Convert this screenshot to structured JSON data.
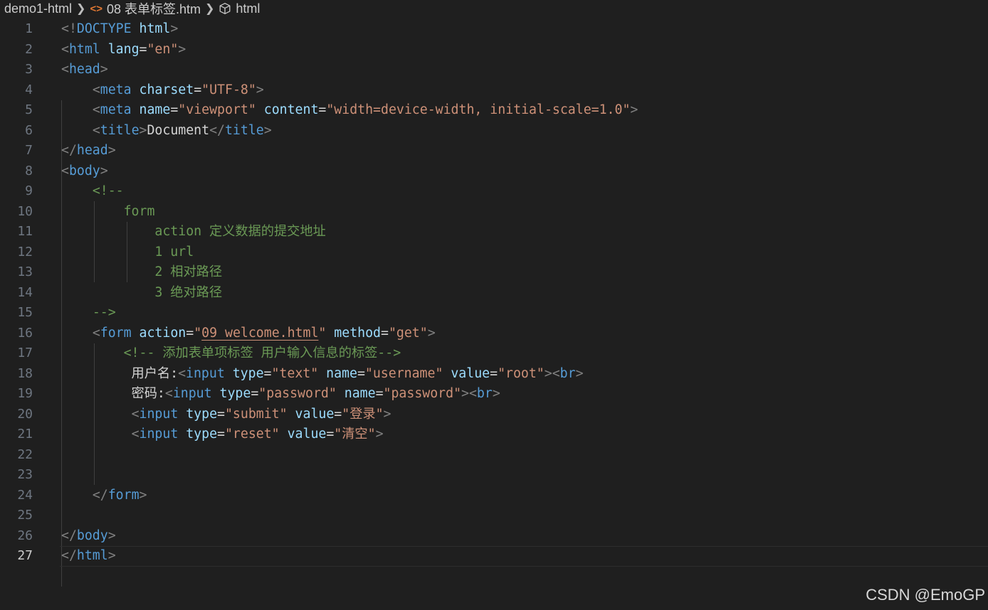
{
  "breadcrumb": {
    "folder": "demo1-html",
    "file": "08 表单标签.htm",
    "symbol": "html",
    "file_icon_glyph": "<>",
    "file_icon_color": "#e37933"
  },
  "editor": {
    "current_line": 27,
    "theme_colors": {
      "background": "#1f1f1f",
      "tag": "#569cd6",
      "attribute": "#9cdcfe",
      "string": "#ce9178",
      "comment": "#6a9955",
      "punctuation": "#808080",
      "text": "#d4d4d4",
      "line_number": "#6e7681"
    },
    "lines": [
      {
        "number": "1",
        "tokens": [
          {
            "t": "p",
            "v": "<!"
          },
          {
            "t": "tag",
            "v": "DOCTYPE"
          },
          {
            "t": "txt",
            "v": " "
          },
          {
            "t": "attr",
            "v": "html"
          },
          {
            "t": "p",
            "v": ">"
          }
        ]
      },
      {
        "number": "2",
        "tokens": [
          {
            "t": "p",
            "v": "<"
          },
          {
            "t": "tag",
            "v": "html"
          },
          {
            "t": "txt",
            "v": " "
          },
          {
            "t": "attr",
            "v": "lang"
          },
          {
            "t": "txt",
            "v": "="
          },
          {
            "t": "str",
            "v": "\"en\""
          },
          {
            "t": "p",
            "v": ">"
          }
        ]
      },
      {
        "number": "3",
        "tokens": [
          {
            "t": "p",
            "v": "<"
          },
          {
            "t": "tag",
            "v": "head"
          },
          {
            "t": "p",
            "v": ">"
          }
        ]
      },
      {
        "number": "4",
        "tokens": [
          {
            "t": "txt",
            "v": "    "
          },
          {
            "t": "p",
            "v": "<"
          },
          {
            "t": "tag",
            "v": "meta"
          },
          {
            "t": "txt",
            "v": " "
          },
          {
            "t": "attr",
            "v": "charset"
          },
          {
            "t": "txt",
            "v": "="
          },
          {
            "t": "str",
            "v": "\"UTF-8\""
          },
          {
            "t": "p",
            "v": ">"
          }
        ]
      },
      {
        "number": "5",
        "tokens": [
          {
            "t": "txt",
            "v": "    "
          },
          {
            "t": "p",
            "v": "<"
          },
          {
            "t": "tag",
            "v": "meta"
          },
          {
            "t": "txt",
            "v": " "
          },
          {
            "t": "attr",
            "v": "name"
          },
          {
            "t": "txt",
            "v": "="
          },
          {
            "t": "str",
            "v": "\"viewport\""
          },
          {
            "t": "txt",
            "v": " "
          },
          {
            "t": "attr",
            "v": "content"
          },
          {
            "t": "txt",
            "v": "="
          },
          {
            "t": "str",
            "v": "\"width=device-width, initial-scale=1.0\""
          },
          {
            "t": "p",
            "v": ">"
          }
        ]
      },
      {
        "number": "6",
        "tokens": [
          {
            "t": "txt",
            "v": "    "
          },
          {
            "t": "p",
            "v": "<"
          },
          {
            "t": "tag",
            "v": "title"
          },
          {
            "t": "p",
            "v": ">"
          },
          {
            "t": "txt",
            "v": "Document"
          },
          {
            "t": "p",
            "v": "</"
          },
          {
            "t": "tag",
            "v": "title"
          },
          {
            "t": "p",
            "v": ">"
          }
        ]
      },
      {
        "number": "7",
        "tokens": [
          {
            "t": "p",
            "v": "</"
          },
          {
            "t": "tag",
            "v": "head"
          },
          {
            "t": "p",
            "v": ">"
          }
        ]
      },
      {
        "number": "8",
        "tokens": [
          {
            "t": "p",
            "v": "<"
          },
          {
            "t": "tag",
            "v": "body"
          },
          {
            "t": "p",
            "v": ">"
          }
        ]
      },
      {
        "number": "9",
        "tokens": [
          {
            "t": "txt",
            "v": "    "
          },
          {
            "t": "com",
            "v": "<!--"
          }
        ]
      },
      {
        "number": "10",
        "tokens": [
          {
            "t": "txt",
            "v": "        "
          },
          {
            "t": "com",
            "v": "form"
          }
        ]
      },
      {
        "number": "11",
        "tokens": [
          {
            "t": "txt",
            "v": "            "
          },
          {
            "t": "com",
            "v": "action 定义数据的提交地址"
          }
        ]
      },
      {
        "number": "12",
        "tokens": [
          {
            "t": "txt",
            "v": "            "
          },
          {
            "t": "com",
            "v": "1 url"
          }
        ]
      },
      {
        "number": "13",
        "tokens": [
          {
            "t": "txt",
            "v": "            "
          },
          {
            "t": "com",
            "v": "2 相对路径"
          }
        ]
      },
      {
        "number": "14",
        "tokens": [
          {
            "t": "txt",
            "v": "            "
          },
          {
            "t": "com",
            "v": "3 绝对路径"
          }
        ]
      },
      {
        "number": "15",
        "tokens": [
          {
            "t": "txt",
            "v": "    "
          },
          {
            "t": "com",
            "v": "-->"
          }
        ]
      },
      {
        "number": "16",
        "tokens": [
          {
            "t": "txt",
            "v": "    "
          },
          {
            "t": "p",
            "v": "<"
          },
          {
            "t": "tag",
            "v": "form"
          },
          {
            "t": "txt",
            "v": " "
          },
          {
            "t": "attr",
            "v": "action"
          },
          {
            "t": "txt",
            "v": "="
          },
          {
            "t": "str",
            "v": "\""
          },
          {
            "t": "str-u",
            "v": "09 welcome.html"
          },
          {
            "t": "str",
            "v": "\""
          },
          {
            "t": "txt",
            "v": " "
          },
          {
            "t": "attr",
            "v": "method"
          },
          {
            "t": "txt",
            "v": "="
          },
          {
            "t": "str",
            "v": "\"get\""
          },
          {
            "t": "p",
            "v": ">"
          }
        ]
      },
      {
        "number": "17",
        "tokens": [
          {
            "t": "txt",
            "v": "        "
          },
          {
            "t": "com",
            "v": "<!-- 添加表单项标签 用户输入信息的标签-->"
          }
        ]
      },
      {
        "number": "18",
        "tokens": [
          {
            "t": "txt",
            "v": "         用户名:"
          },
          {
            "t": "p",
            "v": "<"
          },
          {
            "t": "tag",
            "v": "input"
          },
          {
            "t": "txt",
            "v": " "
          },
          {
            "t": "attr",
            "v": "type"
          },
          {
            "t": "txt",
            "v": "="
          },
          {
            "t": "str",
            "v": "\"text\""
          },
          {
            "t": "txt",
            "v": " "
          },
          {
            "t": "attr",
            "v": "name"
          },
          {
            "t": "txt",
            "v": "="
          },
          {
            "t": "str",
            "v": "\"username\""
          },
          {
            "t": "txt",
            "v": " "
          },
          {
            "t": "attr",
            "v": "value"
          },
          {
            "t": "txt",
            "v": "="
          },
          {
            "t": "str",
            "v": "\"root\""
          },
          {
            "t": "p",
            "v": "><"
          },
          {
            "t": "tag",
            "v": "br"
          },
          {
            "t": "p",
            "v": ">"
          }
        ]
      },
      {
        "number": "19",
        "tokens": [
          {
            "t": "txt",
            "v": "         密码:"
          },
          {
            "t": "p",
            "v": "<"
          },
          {
            "t": "tag",
            "v": "input"
          },
          {
            "t": "txt",
            "v": " "
          },
          {
            "t": "attr",
            "v": "type"
          },
          {
            "t": "txt",
            "v": "="
          },
          {
            "t": "str",
            "v": "\"password\""
          },
          {
            "t": "txt",
            "v": " "
          },
          {
            "t": "attr",
            "v": "name"
          },
          {
            "t": "txt",
            "v": "="
          },
          {
            "t": "str",
            "v": "\"password\""
          },
          {
            "t": "p",
            "v": "><"
          },
          {
            "t": "tag",
            "v": "br"
          },
          {
            "t": "p",
            "v": ">"
          }
        ]
      },
      {
        "number": "20",
        "tokens": [
          {
            "t": "txt",
            "v": "         "
          },
          {
            "t": "p",
            "v": "<"
          },
          {
            "t": "tag",
            "v": "input"
          },
          {
            "t": "txt",
            "v": " "
          },
          {
            "t": "attr",
            "v": "type"
          },
          {
            "t": "txt",
            "v": "="
          },
          {
            "t": "str",
            "v": "\"submit\""
          },
          {
            "t": "txt",
            "v": " "
          },
          {
            "t": "attr",
            "v": "value"
          },
          {
            "t": "txt",
            "v": "="
          },
          {
            "t": "str",
            "v": "\"登录\""
          },
          {
            "t": "p",
            "v": ">"
          }
        ]
      },
      {
        "number": "21",
        "tokens": [
          {
            "t": "txt",
            "v": "         "
          },
          {
            "t": "p",
            "v": "<"
          },
          {
            "t": "tag",
            "v": "input"
          },
          {
            "t": "txt",
            "v": " "
          },
          {
            "t": "attr",
            "v": "type"
          },
          {
            "t": "txt",
            "v": "="
          },
          {
            "t": "str",
            "v": "\"reset\""
          },
          {
            "t": "txt",
            "v": " "
          },
          {
            "t": "attr",
            "v": "value"
          },
          {
            "t": "txt",
            "v": "="
          },
          {
            "t": "str",
            "v": "\"清空\""
          },
          {
            "t": "p",
            "v": ">"
          }
        ]
      },
      {
        "number": "22",
        "tokens": []
      },
      {
        "number": "23",
        "tokens": []
      },
      {
        "number": "24",
        "tokens": [
          {
            "t": "txt",
            "v": "    "
          },
          {
            "t": "p",
            "v": "</"
          },
          {
            "t": "tag",
            "v": "form"
          },
          {
            "t": "p",
            "v": ">"
          }
        ]
      },
      {
        "number": "25",
        "tokens": []
      },
      {
        "number": "26",
        "tokens": [
          {
            "t": "p",
            "v": "</"
          },
          {
            "t": "tag",
            "v": "body"
          },
          {
            "t": "p",
            "v": ">"
          }
        ]
      },
      {
        "number": "27",
        "tokens": [
          {
            "t": "p",
            "v": "</"
          },
          {
            "t": "tag",
            "v": "html"
          },
          {
            "t": "p",
            "v": ">"
          }
        ]
      }
    ]
  },
  "watermark": "CSDN @EmoGP"
}
